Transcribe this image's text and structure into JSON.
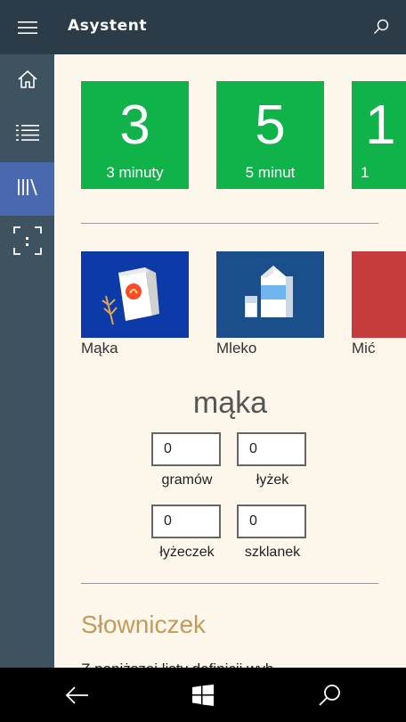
{
  "header": {
    "title": "Asystent"
  },
  "icons": {
    "menu": "hamburger-icon",
    "search": "search-icon",
    "home": "home-icon",
    "list": "list-icon",
    "library": "library-icon",
    "scan": "scan-icon",
    "back": "back-arrow-icon",
    "windows": "windows-logo-icon"
  },
  "colors": {
    "titlebar": "#2b3b47",
    "sidebar": "#3e525f",
    "sidebar_active": "#4a68b0",
    "timer_tile": "#10b24a",
    "background": "#fdf6ea",
    "accent_title": "#c59a5a"
  },
  "timers": [
    {
      "number": "3",
      "label": "3 minuty"
    },
    {
      "number": "5",
      "label": "5 minut"
    },
    {
      "number": "1",
      "label": "1"
    }
  ],
  "ingredients": [
    {
      "name": "Mąka",
      "bg": "#0c3aa8"
    },
    {
      "name": "Mleko",
      "bg": "#1a4f8c"
    },
    {
      "name": "Mić",
      "bg": "#c63b3b"
    }
  ],
  "converter": {
    "title": "mąka",
    "fields": [
      {
        "value": "0",
        "label": "gramów"
      },
      {
        "value": "0",
        "label": "łyżek"
      },
      {
        "value": "0",
        "label": "łyżeczek"
      },
      {
        "value": "0",
        "label": "szklanek"
      }
    ]
  },
  "glossary": {
    "title": "Słowniczek",
    "text": "Z poniższej listy definicji wyb"
  }
}
